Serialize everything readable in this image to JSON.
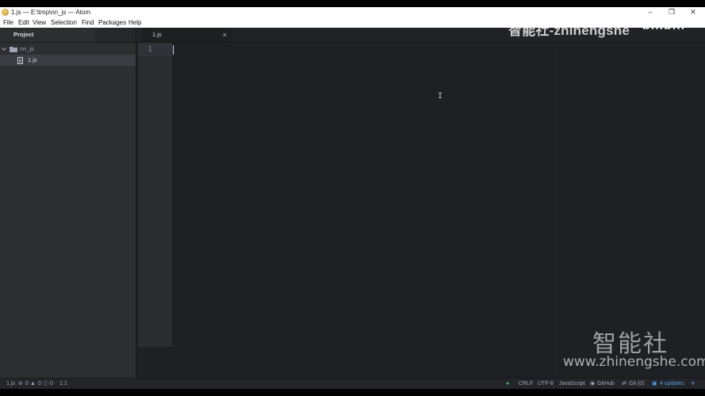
{
  "window": {
    "title": "1.js — E:\\tmp\\nn_js — Atom",
    "controls": {
      "minimize": "–",
      "restore": "❐",
      "close": "✕"
    }
  },
  "menu": [
    "File",
    "Edit",
    "View",
    "Selection",
    "Find",
    "Packages",
    "Help"
  ],
  "tree": {
    "header": "Project",
    "root_folder": "nn_js",
    "files": [
      "1.js"
    ]
  },
  "editor": {
    "active_tab": "1.js",
    "close_glyph": "×",
    "line_numbers": [
      "1"
    ],
    "mouse_cursor": "I"
  },
  "status": {
    "file": "1.js",
    "errors": "0",
    "warnings": "0",
    "infos": "0",
    "cursor_position": "1:1",
    "line_ending": "CRLF",
    "encoding": "UTF-8",
    "grammar": "JavaScript",
    "github": "GitHub",
    "git": "Git (0)",
    "updates": "4 updates"
  },
  "watermarks": {
    "top": "智能社-zhinengshe",
    "top_logo": "bilibili",
    "bottom_cn": "智能社",
    "bottom_url": "www.zhinengshe.com"
  },
  "colors": {
    "editor_bg": "#1f2023",
    "sidebar_bg": "#2c2e30",
    "accent_green": "#2fc46a",
    "accent_blue": "#4a9be8"
  }
}
